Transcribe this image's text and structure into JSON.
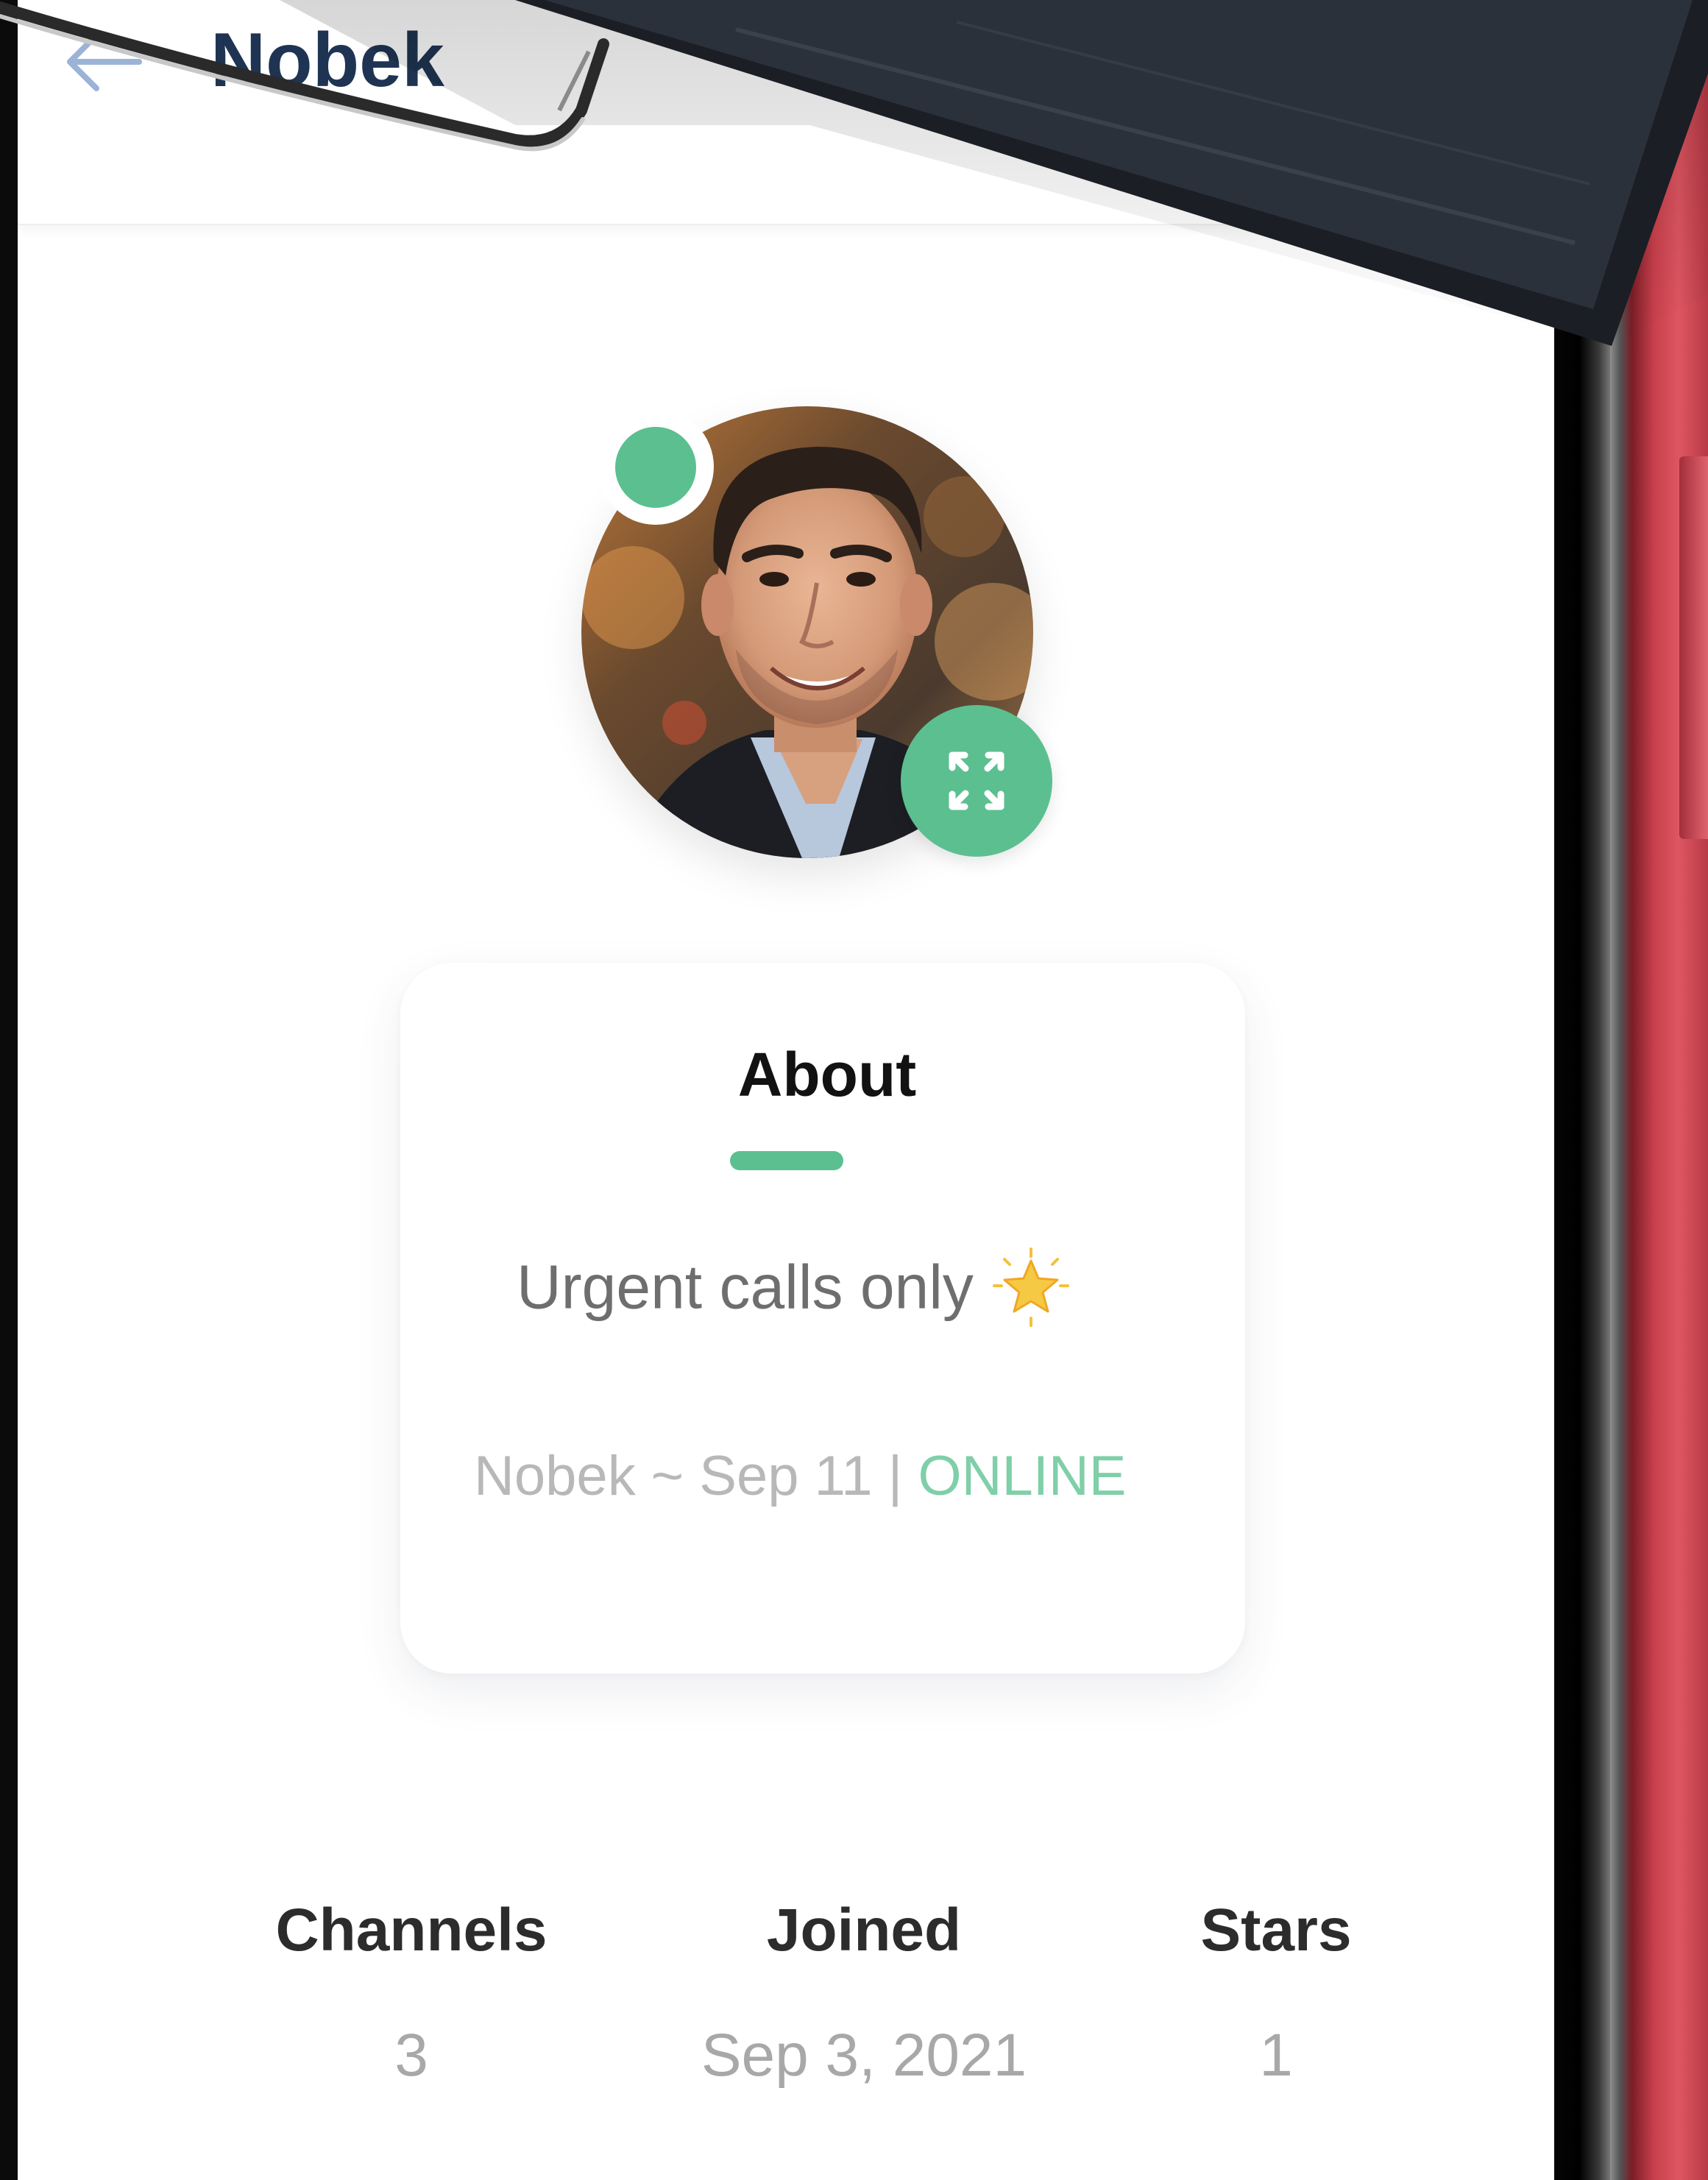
{
  "header": {
    "back_icon": "arrow-left-icon",
    "title": "Nobek"
  },
  "profile": {
    "status": "online",
    "status_color": "#5cbf90",
    "expand_icon": "expand-arrows-icon"
  },
  "about": {
    "title": "About",
    "bio": "Urgent calls only",
    "bio_emoji": "star-icon",
    "meta_prefix": "Nobek ~ Sep 11 | ",
    "status_text": "ONLINE"
  },
  "stats": [
    {
      "label": "Channels",
      "value": "3"
    },
    {
      "label": "Joined",
      "value": "Sep 3, 2021"
    },
    {
      "label": "Stars",
      "value": "1"
    }
  ],
  "colors": {
    "accent": "#5cbf90",
    "title": "#1f3452",
    "online": "#7fcfa8",
    "case": "#d24a56"
  }
}
